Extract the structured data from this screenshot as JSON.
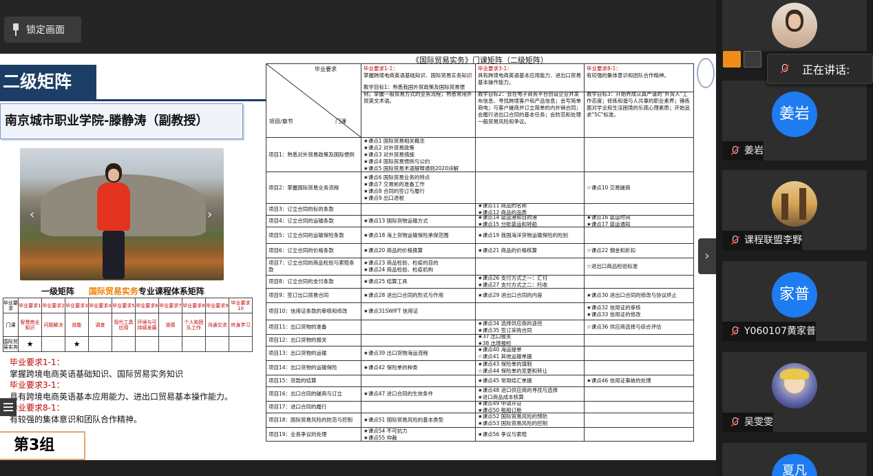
{
  "toolbar": {
    "lock_label": "锁定画面"
  },
  "slide": {
    "title": "二级矩阵",
    "school": "南京城市职业学院-滕静涛（副教授）",
    "matrix_caption_prefix": "一级矩阵",
    "matrix_caption_highlight": "国际贸易实务",
    "matrix_caption_suffix": "专业课程体系矩阵",
    "mini_table": {
      "corner_top": "毕业要求",
      "corner_bottom": "门课",
      "headers": [
        "毕业要求1",
        "毕业要求2",
        "毕业要求3",
        "毕业要求4",
        "毕业要求5",
        "毕业要求6",
        "毕业要求7",
        "毕业要求8",
        "毕业要求9",
        "毕业要求10"
      ],
      "subheaders": [
        "智慧商业知识",
        "问题解决",
        "技能",
        "调查",
        "现代工具应用",
        "环境与可持续发展",
        "道德",
        "个人和团队工作",
        "沟通交流",
        "终身学习"
      ],
      "row_label": "国际贸易实务",
      "row_marks": [
        "★",
        "",
        "★",
        "",
        "",
        "",
        "",
        "",
        "",
        ""
      ]
    },
    "requirements": [
      {
        "heading": "毕业要求1-1：",
        "text": "掌握跨境电商英语基础知识、国际贸易实务知识"
      },
      {
        "heading": "毕业要求3-1：",
        "text": "具有跨境电商英语基本应用能力、进出口贸易基本操作能力。"
      },
      {
        "heading": "毕业要求8-1：",
        "text": "有较强的集体意识和团队合作精神。"
      }
    ],
    "group": "第3组"
  },
  "doc": {
    "title": "《国际贸易实务》门课矩阵（二级矩阵）",
    "diag_top": "毕业要求",
    "diag_left": "项目/章节",
    "diag_right": "门课",
    "req_cols": [
      {
        "head": "毕业要求1-1：",
        "text": "掌握跨境电商英语基础知识、国际贸易实务知识",
        "goal": "教学目标1：熟悉我国外贸政策及国际贸易惯例；掌握一般贸易方式的业务流程；熟悉常用外贸英文术语。"
      },
      {
        "head": "毕业要求3-1：",
        "text": "具有跨境电商英语基本应用能力、进出口贸易基本操作能力。",
        "goal": "教学目标2：会在电子商务平台创设企业并发布信息、寻找跨境客户和产品信息；会写简单商电；与客户磋商并订立简单的内外销合同；会履行进出口合同的基本任务；会防范和处理一般贸易风险和争议。"
      },
      {
        "head": "毕业要求8-1：",
        "text": "有较强的集体意识和团队合作精神。",
        "goal": "教学目标3：开始养成认真严谨的\"外贸人\"工作态度；修炼和谐与人共事的职业素养；锤炼面对学业和生活困境的乐观心理素质；开始追求\"5C\"标准。"
      }
    ],
    "rows": [
      {
        "p": "项目1：熟悉对外贸易政策及国际惯例",
        "a": "★课点1 国际贸易相关概念\n★课点2 对外贸易政策\n★课点3 对外贸易措施\n★课点4 国际贸易惯例与公约\n★课点5 国际贸易术语解释通则2020详解",
        "b": "",
        "c": ""
      },
      {
        "p": "项目2：掌握国际贸易业务流程",
        "a": "★课点6 国际贸易业务的特点\n★课点7 交易前的准备工作\n★课点8 合同的签订与履行\n★课点9 出口退税",
        "b": "",
        "c": "☆课点10 交易磋商"
      },
      {
        "p": "项目3：订立合同的标的条款",
        "a": "",
        "b": "★课点11 商品的名称\n★课点12 商品的品质",
        "c": ""
      },
      {
        "p": "项目4：订立合同的运输条款",
        "a": "★课点13 国际货物运输方式",
        "b": "★课点14 装运港和目的港\n★课点15 分批装运和转船",
        "c": "★课点16 装运时间\n★课点17 装运通知"
      },
      {
        "p": "项目5：订立合同的运输保险条款",
        "a": "★课点18 海上货物运输保险承保范围",
        "b": "★课点19 我国海洋货物运输保险的险别",
        "c": ""
      },
      {
        "p": "项目6：订立合同的价格条款",
        "a": "★课点20 商品的价格换算",
        "b": "★课点21 商品的价格核算",
        "c": "☆课点22 佣金和折扣"
      },
      {
        "p": "项目7：订立合同的商品检验与索赔条款",
        "a": "★课点23 商品检验、检疫的目的\n★课点24 商品检验、检疫机构",
        "b": "",
        "c": "☆进出口商品检验标准"
      },
      {
        "p": "项目8：订立合同的支付条款",
        "a": "★课点25 结算工具",
        "b": "★课点26 支付方式之一：汇付\n★课点27 支付方式之二：托收",
        "c": ""
      },
      {
        "p": "项目9：签订出口贸易合同",
        "a": "★课点28 进出口合同的形式与作用",
        "b": "★课点29 进出口合同的内容",
        "c": "★课点30 进出口合同的修改与协议终止"
      },
      {
        "p": "项目10：信用证条款的审核和修改",
        "a": "★课点31SWIFT 信用证",
        "b": "",
        "c": "★课点32 信用证的审核\n★课点33 信用证的修改"
      },
      {
        "p": "项目11：出口货物的准备",
        "a": "",
        "b": "★课点34 选择供应商的途径\n★课点35 签订采购合同",
        "c": "☆课点36 供应商选择与综合评估"
      },
      {
        "p": "项目12：出口货物的报关",
        "a": "",
        "b": "★37 出口报关\n★38 出境报检",
        "c": ""
      },
      {
        "p": "项目13：出口货物的运输",
        "a": "★课点39 出口货物海运流程",
        "b": "★课点40 海运提单\n☆课点41 其他运输单据",
        "c": ""
      },
      {
        "p": "项目14：出口货物的运输保险",
        "a": "★课点42 保险单的种类",
        "b": "★课点43 保险单的填制\n☆课点44 保险单的变更和转让",
        "c": ""
      },
      {
        "p": "项目15：货款的结算",
        "a": "",
        "b": "★课点45 常用结汇单据",
        "c": "★课点46 信用证事故的处理"
      },
      {
        "p": "项目16：出口合同的磋商与订立",
        "a": "★课点47 进口合同的生效条件",
        "b": "★课点48 进口供应商的寻找与选择\n★进口商品成本核算",
        "c": ""
      },
      {
        "p": "项目17：进口合同的履行",
        "a": "",
        "b": "★课点49 申请开证\n★课点50 租船订舱",
        "c": ""
      },
      {
        "p": "项目18：国际贸易风险的防范与控制",
        "a": "★课点51 国际贸易风险的基本类型",
        "b": "★课点52 国际贸易风险的预防\n★课点53 国际贸易风险的控制",
        "c": ""
      },
      {
        "p": "项目19：业务争议的处理",
        "a": "★课点54 不可抗力\n★课点55 仲裁",
        "b": "★课点56 争议与索赔",
        "c": ""
      }
    ]
  },
  "sidebar": {
    "speaking_label": "正在讲话:",
    "participants": [
      {
        "name": "姜岩",
        "avatar_text": "姜岩",
        "kind": "text"
      },
      {
        "name": "课程联盟李野",
        "avatar_text": "",
        "kind": "photo"
      },
      {
        "name": "Y060107黄家普",
        "avatar_text": "家普",
        "kind": "text"
      },
      {
        "name": "吴雯雯",
        "avatar_text": "",
        "kind": "photo"
      }
    ],
    "partial_avatar_text": "夏凡"
  },
  "colors": {
    "accent_blue": "#1e7bf0",
    "title_navy": "#1c3d66",
    "highlight_orange": "#f07d00",
    "requirement_red": "#c00000"
  }
}
